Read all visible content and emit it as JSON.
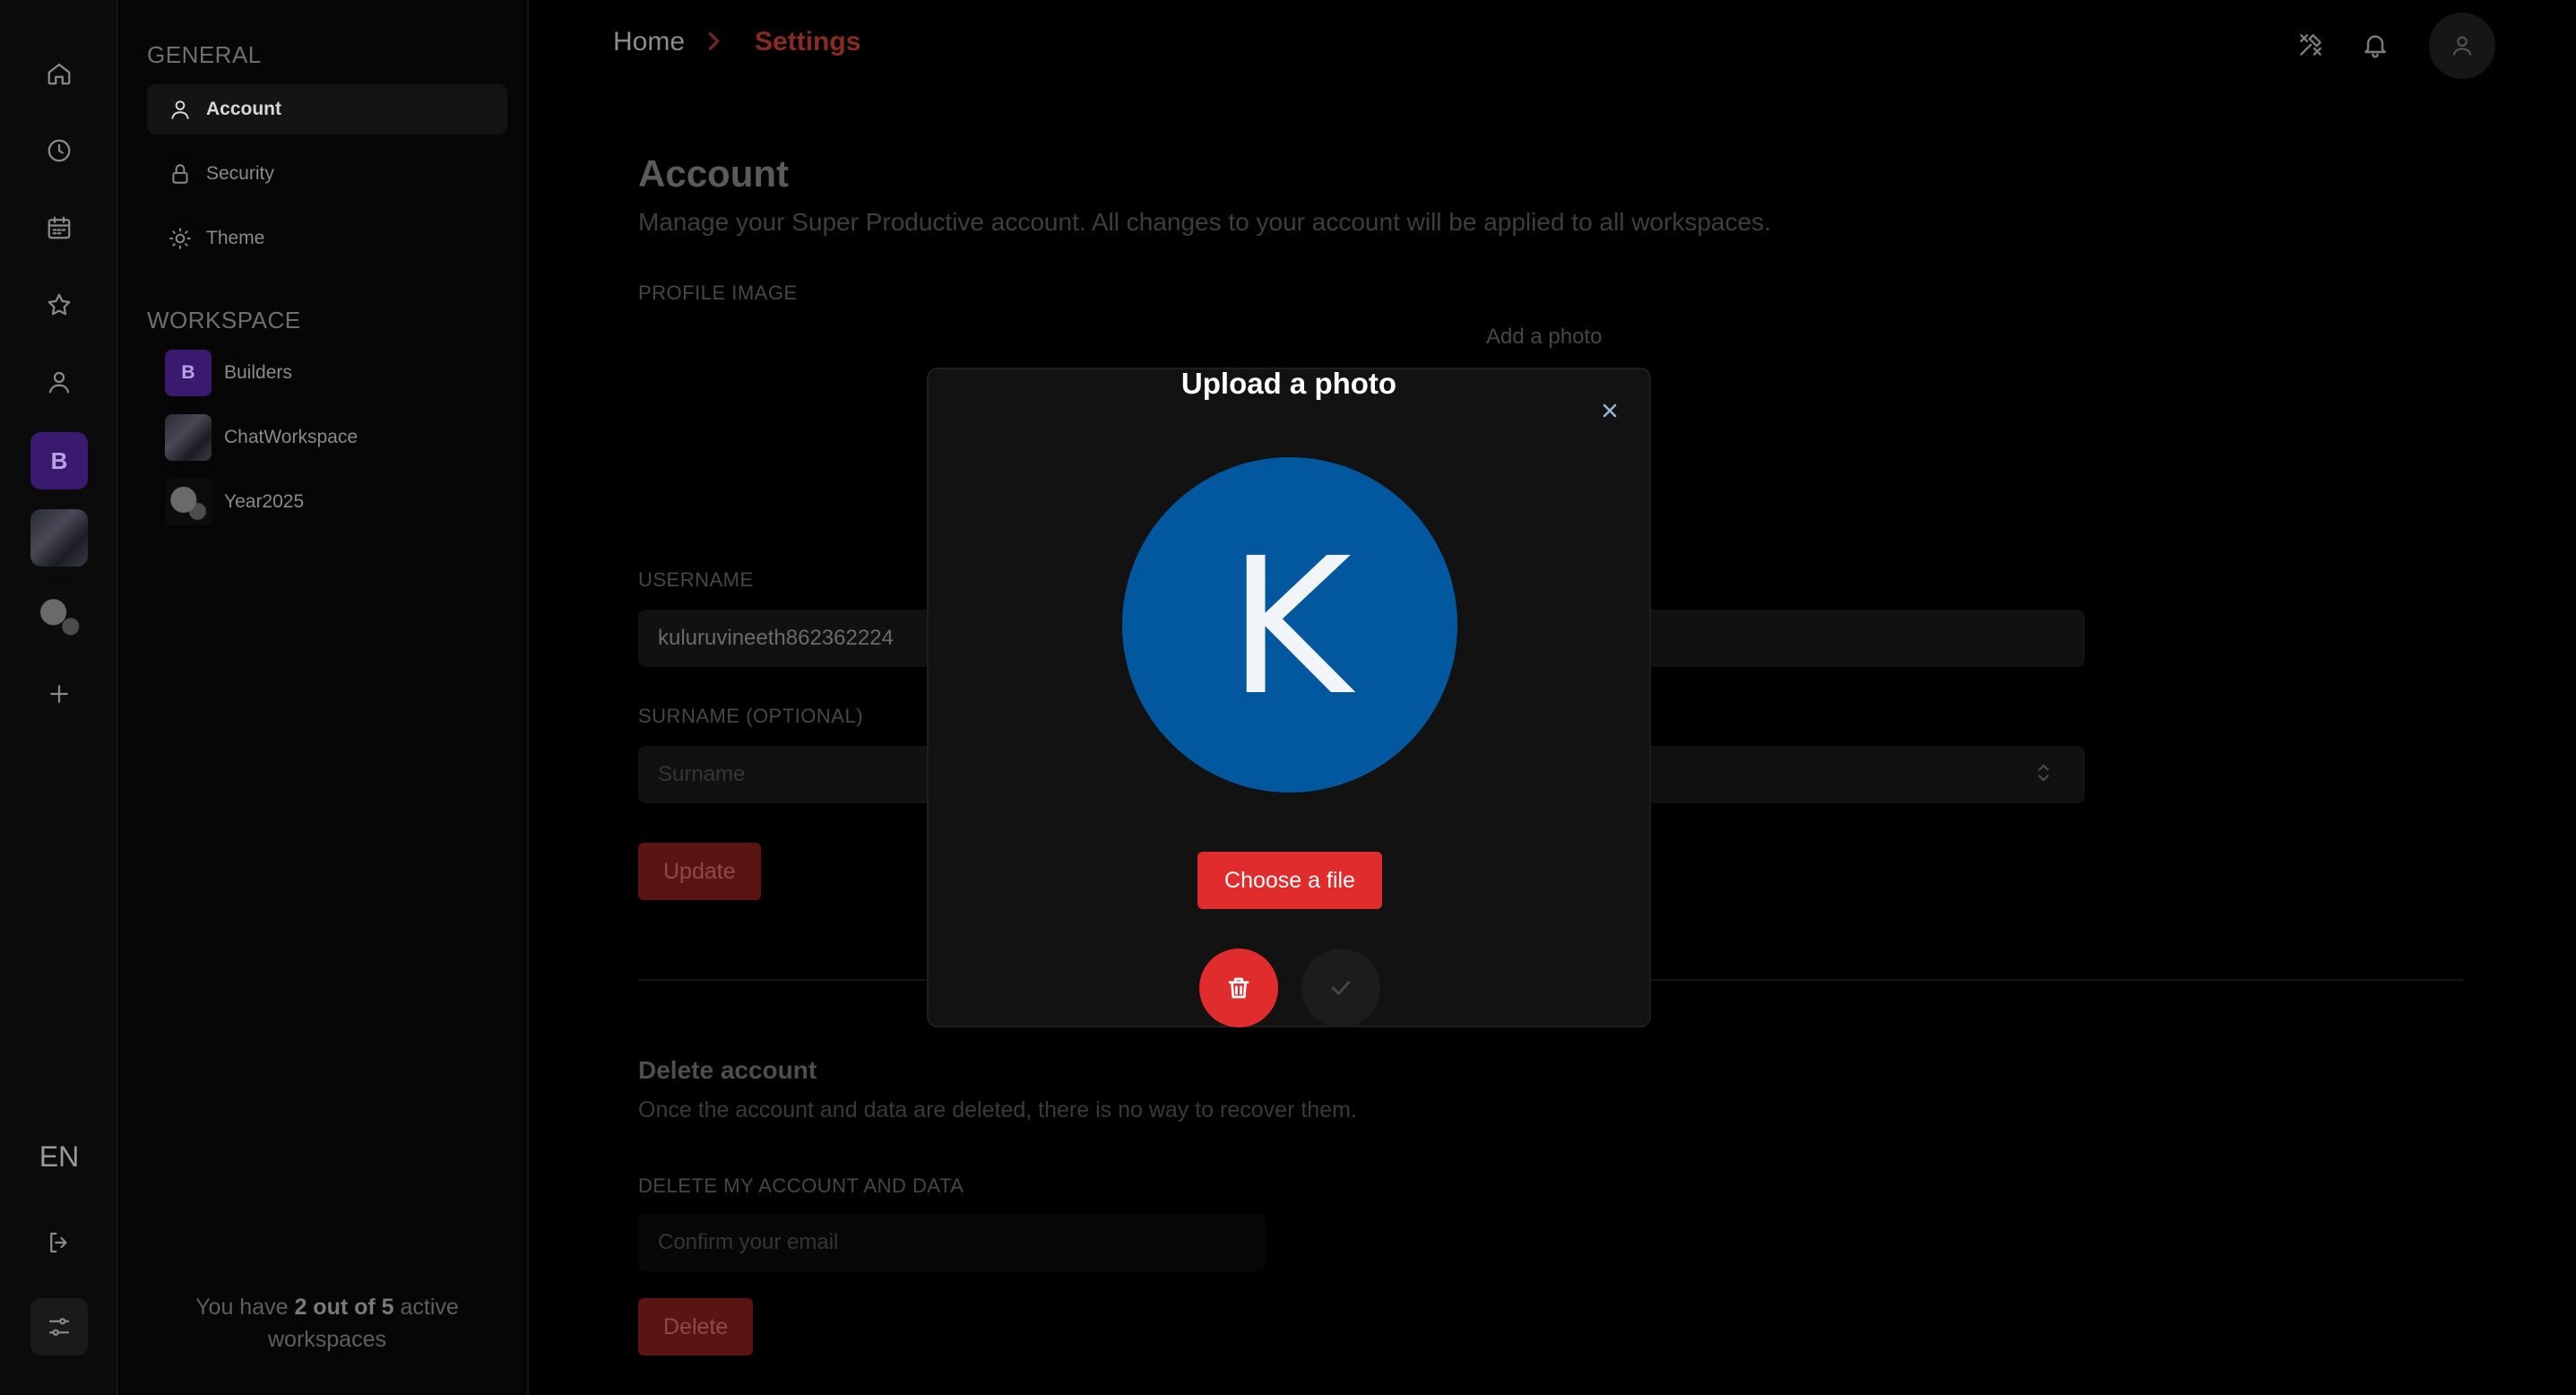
{
  "rail": {
    "language": "EN",
    "workspace_badge": "B"
  },
  "sidenav": {
    "general_title": "GENERAL",
    "items": [
      {
        "label": "Account"
      },
      {
        "label": "Security"
      },
      {
        "label": "Theme"
      }
    ],
    "workspace_title": "WORKSPACE",
    "workspaces": [
      {
        "label": "Builders",
        "badge": "B"
      },
      {
        "label": "ChatWorkspace"
      },
      {
        "label": "Year2025"
      }
    ],
    "footer": {
      "prefix": "You have ",
      "count": "2 out of 5",
      "suffix": " active workspaces"
    }
  },
  "breadcrumb": {
    "home": "Home",
    "current": "Settings"
  },
  "main": {
    "title": "Account",
    "description": "Manage your Super Productive account. All changes to your account will be applied to all workspaces.",
    "profile_image_label": "PROFILE IMAGE",
    "add_photo": "Add a photo",
    "username_label": "USERNAME",
    "username_value": "kuluruvineeth862362224",
    "surname_label": "SURNAME (OPTIONAL)",
    "surname_placeholder": "Surname",
    "update_label": "Update",
    "delete_title": "Delete account",
    "delete_description": "Once the account and data are deleted, there is no way to recover them.",
    "delete_field_label": "DELETE MY ACCOUNT AND DATA",
    "confirm_placeholder": "Confirm your email",
    "delete_button": "Delete"
  },
  "modal": {
    "title": "Upload a photo",
    "avatar_letter": "K",
    "choose_file": "Choose a file"
  },
  "colors": {
    "accent": "#e02c2c",
    "avatar_bg": "#02589e"
  }
}
